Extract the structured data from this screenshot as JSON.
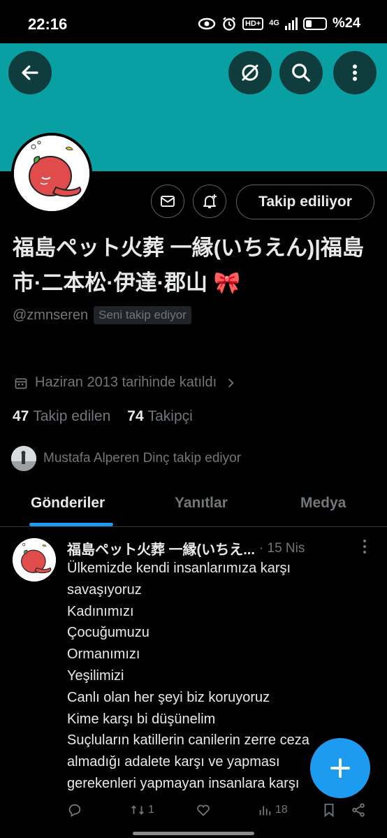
{
  "status_bar": {
    "time": "22:16",
    "network": "HD+",
    "network_gen": "4G",
    "battery": "%24"
  },
  "header": {
    "back_icon": "arrow-left-icon",
    "mute_icon": "circle-slash-icon",
    "search_icon": "search-icon",
    "more_icon": "more-vertical-icon"
  },
  "profile": {
    "display_name": "福島ペット火葬 一縁(いちえん)|福島市·二本松·伊達·郡山 🎀",
    "handle": "@zmnseren",
    "follows_you": "Seni takip ediyor",
    "joined": "Haziran 2013 tarihinde katıldı",
    "following_count": "47",
    "following_label": "Takip edilen",
    "followers_count": "74",
    "followers_label": "Takipçi",
    "followed_by": "Mustafa Alperen Dinç takip ediyor",
    "follow_button": "Takip ediliyor"
  },
  "tabs": [
    {
      "label": "Gönderiler",
      "active": true
    },
    {
      "label": "Yanıtlar",
      "active": false
    },
    {
      "label": "Medya",
      "active": false
    }
  ],
  "tweet": {
    "author": "福島ペット火葬 一縁(いちえ...",
    "date": "· 15 Nis",
    "lines": [
      "Ülkemizde kendi insanlarımıza karşı",
      "savaşıyoruz",
      "Kadınımızı",
      "Çocuğumuzu",
      "Ormanımızı",
      "Yeşilimizi",
      "Canlı olan her şeyi biz koruyoruz",
      "Kime karşı bi düşünelim",
      "Suçluların katillerin canilerin zerre ceza",
      "almadığı  adalete karşı ve yapması",
      "gerekenleri yapmayan insanlara karşı"
    ],
    "retweets": "1",
    "views": "18"
  },
  "colors": {
    "banner": "#08a0a3",
    "accent": "#1d9bf0",
    "muted_text": "#71767b",
    "text": "#e7e9ea"
  }
}
